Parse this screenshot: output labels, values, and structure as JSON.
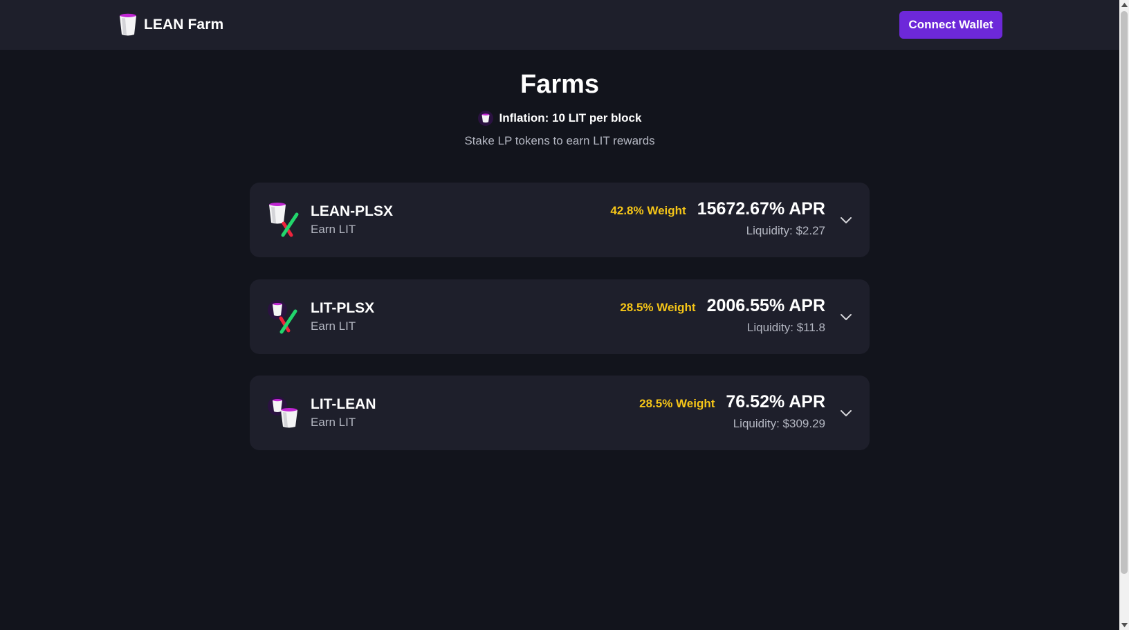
{
  "header": {
    "brand_name": "LEAN Farm",
    "connect_label": "Connect Wallet",
    "accent_color": "#6d28d9"
  },
  "hero": {
    "title": "Farms",
    "inflation": "Inflation: 10 LIT per block",
    "subtitle": "Stake LP tokens to earn LIT rewards"
  },
  "farms": [
    {
      "name": "LEAN-PLSX",
      "earn": "Earn LIT",
      "weight": "42.8% Weight",
      "apr": "15672.67% APR",
      "liquidity": "Liquidity: $2.27",
      "icon": "lean-plsx-pair-icon"
    },
    {
      "name": "LIT-PLSX",
      "earn": "Earn LIT",
      "weight": "28.5% Weight",
      "apr": "2006.55% APR",
      "liquidity": "Liquidity: $11.8",
      "icon": "lit-plsx-pair-icon"
    },
    {
      "name": "LIT-LEAN",
      "earn": "Earn LIT",
      "weight": "28.5% Weight",
      "apr": "76.52% APR",
      "liquidity": "Liquidity: $309.29",
      "icon": "lit-lean-pair-icon"
    }
  ],
  "colors": {
    "background": "#12141c",
    "card": "#1e1f2b",
    "weight": "#f5c518",
    "muted_text": "#b4b7c2"
  }
}
